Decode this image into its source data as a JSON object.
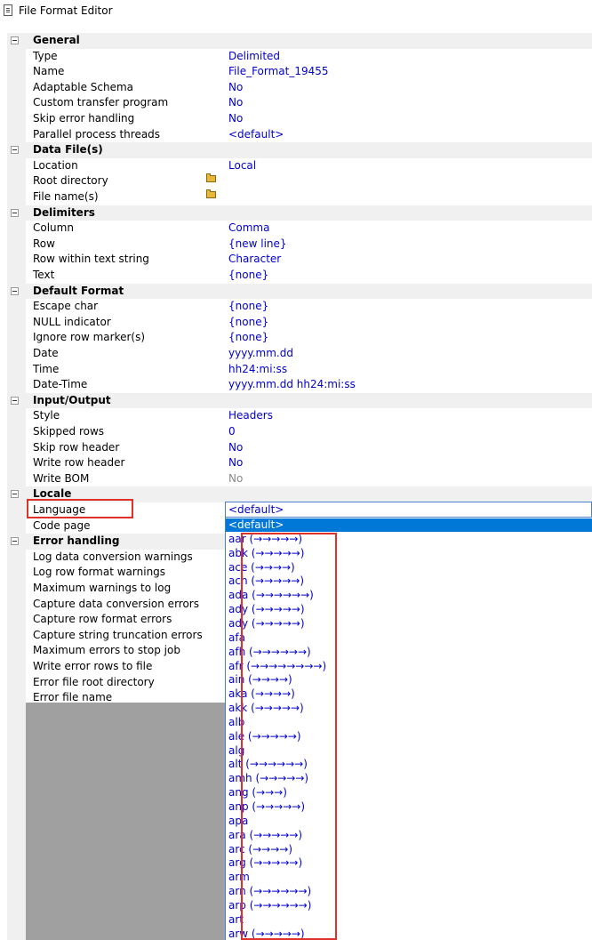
{
  "window": {
    "title": "File Format Editor"
  },
  "sections": [
    {
      "label": "General",
      "props": [
        {
          "name": "Type",
          "value": "Delimited"
        },
        {
          "name": "Name",
          "value": "File_Format_19455"
        },
        {
          "name": "Adaptable Schema",
          "value": "No"
        },
        {
          "name": "Custom transfer program",
          "value": "No"
        },
        {
          "name": "Skip error handling",
          "value": "No"
        },
        {
          "name": "Parallel process threads",
          "value": "<default>"
        }
      ]
    },
    {
      "label": "Data File(s)",
      "props": [
        {
          "name": "Location",
          "value": "Local"
        },
        {
          "name": "Root directory",
          "value": "",
          "icon": "folder-open-icon"
        },
        {
          "name": "File name(s)",
          "value": "",
          "icon": "folder-open-icon"
        }
      ]
    },
    {
      "label": "Delimiters",
      "props": [
        {
          "name": "Column",
          "value": "Comma"
        },
        {
          "name": "Row",
          "value": "{new line}"
        },
        {
          "name": "Row within text string",
          "value": "Character"
        },
        {
          "name": "Text",
          "value": "{none}"
        }
      ]
    },
    {
      "label": "Default Format",
      "props": [
        {
          "name": "Escape char",
          "value": "{none}"
        },
        {
          "name": "NULL indicator",
          "value": "{none}"
        },
        {
          "name": "Ignore row marker(s)",
          "value": "{none}"
        },
        {
          "name": "Date",
          "value": "yyyy.mm.dd"
        },
        {
          "name": "Time",
          "value": "hh24:mi:ss"
        },
        {
          "name": "Date-Time",
          "value": "yyyy.mm.dd hh24:mi:ss"
        }
      ]
    },
    {
      "label": "Input/Output",
      "props": [
        {
          "name": "Style",
          "value": "Headers"
        },
        {
          "name": "Skipped rows",
          "value": "0"
        },
        {
          "name": "Skip row header",
          "value": "No"
        },
        {
          "name": "Write row header",
          "value": "No"
        },
        {
          "name": "Write BOM",
          "value": "No",
          "disabled": true
        }
      ]
    },
    {
      "label": "Locale",
      "props": [
        {
          "name": "Language",
          "value": "<default>"
        },
        {
          "name": "Code page",
          "value": ""
        }
      ]
    },
    {
      "label": "Error handling",
      "props": [
        {
          "name": "Log data conversion warnings",
          "value": ""
        },
        {
          "name": "Log row format warnings",
          "value": ""
        },
        {
          "name": "Maximum warnings to log",
          "value": ""
        },
        {
          "name": "Capture data conversion errors",
          "value": ""
        },
        {
          "name": "Capture row format errors",
          "value": ""
        },
        {
          "name": "Capture string truncation errors",
          "value": ""
        },
        {
          "name": "Maximum errors to stop job",
          "value": ""
        },
        {
          "name": "Write error rows to file",
          "value": ""
        },
        {
          "name": "Error file root directory",
          "value": ""
        },
        {
          "name": "Error file name",
          "value": ""
        }
      ]
    }
  ],
  "language_dropdown": {
    "selected": "<default>",
    "options": [
      "<default>",
      "aar (→→→→→)",
      "abk (→→→→→)",
      "ace (→→→→)",
      "ach (→→→→→)",
      "ada (→→→→→→)",
      "ady (→→→→→)",
      "ady (→→→→→)",
      "afa",
      "afh (→→→→→→)",
      "afr (→→→→→→→→)",
      "ain (→→→→)",
      "aka (→→→→)",
      "akk (→→→→→)",
      "alb",
      "ale (→→→→→)",
      "alg",
      "alt (→→→→→→)",
      "amh (→→→→→)",
      "ang (→→→)",
      "anp (→→→→→)",
      "apa",
      "ara (→→→→→)",
      "arc (→→→→)",
      "arg (→→→→→)",
      "arm",
      "arn (→→→→→→)",
      "arp (→→→→→→)",
      "art",
      "arw (→→→→→)"
    ]
  },
  "colors": {
    "value_text": "#0000cc",
    "selection": "#0078d7",
    "highlight_box": "#e0302a",
    "section_bg": "#f0f0f0",
    "empty_area": "#a0a0a0"
  }
}
